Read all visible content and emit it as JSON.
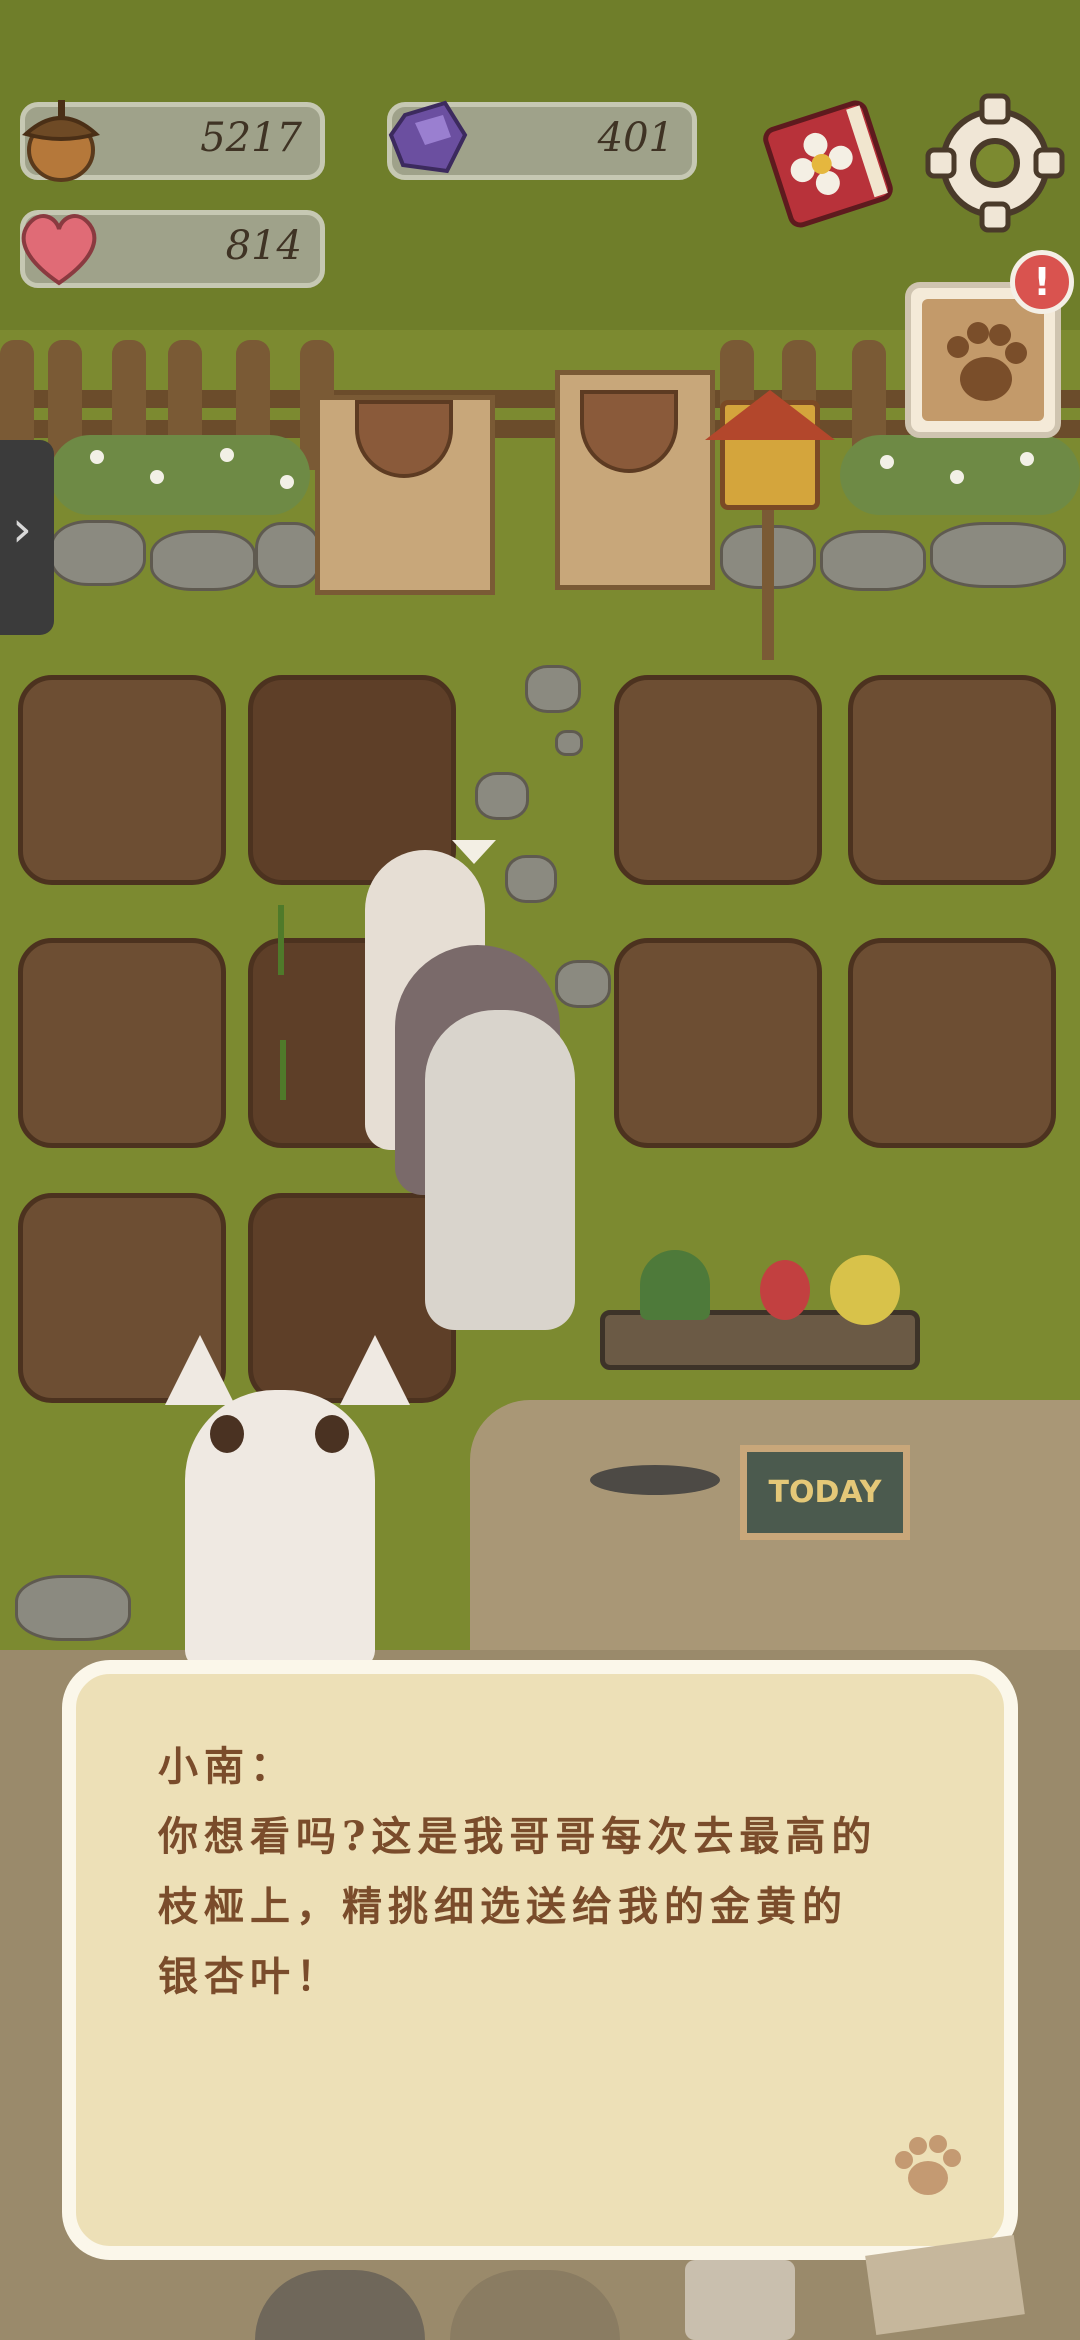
{
  "resources": {
    "acorns": {
      "value": "5217",
      "icon": "acorn-icon"
    },
    "gems": {
      "value": "401",
      "icon": "purple-gem-icon"
    },
    "hearts": {
      "value": "814",
      "icon": "heart-icon"
    }
  },
  "top_buttons": {
    "book_icon": "flower-book-icon",
    "settings_icon": "gear-icon",
    "notice_icon": "paw-note-icon",
    "notice_badge": "!"
  },
  "side_tab": {
    "icon": "chevron-right-icon",
    "glyph": "›"
  },
  "board": {
    "text": "TODAY"
  },
  "dialog": {
    "speaker": "小南：",
    "lines": [
      "你想看吗?这是我哥哥每次去最高的",
      "枝桠上，精挑细选送给我的金黄的",
      "银杏叶！"
    ],
    "continue_icon": "paw-icon"
  },
  "colors": {
    "grass": "#7c8a30",
    "soil": "#6d4e33",
    "dialog_bg": "#ede0b7",
    "dialog_text": "#7a4c2b",
    "notice_badge": "#d9534f"
  }
}
